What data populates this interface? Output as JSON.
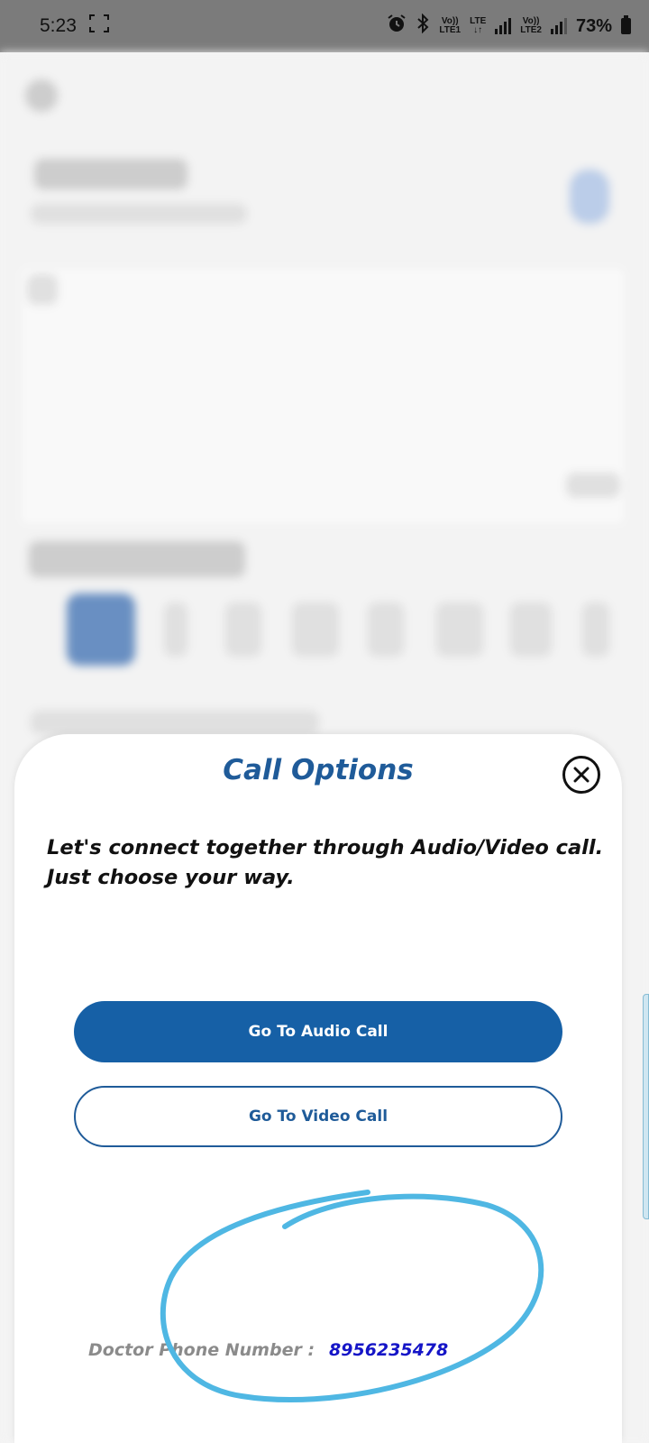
{
  "status_bar": {
    "time": "5:23",
    "sim1_top": "Vo))",
    "sim1_bottom": "LTE1",
    "lte": "LTE",
    "sim2_top": "Vo))",
    "sim2_bottom": "LTE2",
    "battery": "73%"
  },
  "dialog": {
    "title": "Call Options",
    "description": "Let's connect together through Audio/Video call. Just choose your way.",
    "audio_button": "Go To Audio Call",
    "video_button": "Go To Video Call",
    "phone_label": "Doctor Phone Number :",
    "phone_number": "8956235478"
  },
  "colors": {
    "accent": "#1660a6",
    "title": "#1f5b99",
    "phone_number": "#1515c7",
    "annotation": "#4fb7e3"
  },
  "icons": [
    "screenshot-icon",
    "alarm-icon",
    "bluetooth-icon",
    "signal-icon",
    "battery-icon",
    "close-icon"
  ]
}
